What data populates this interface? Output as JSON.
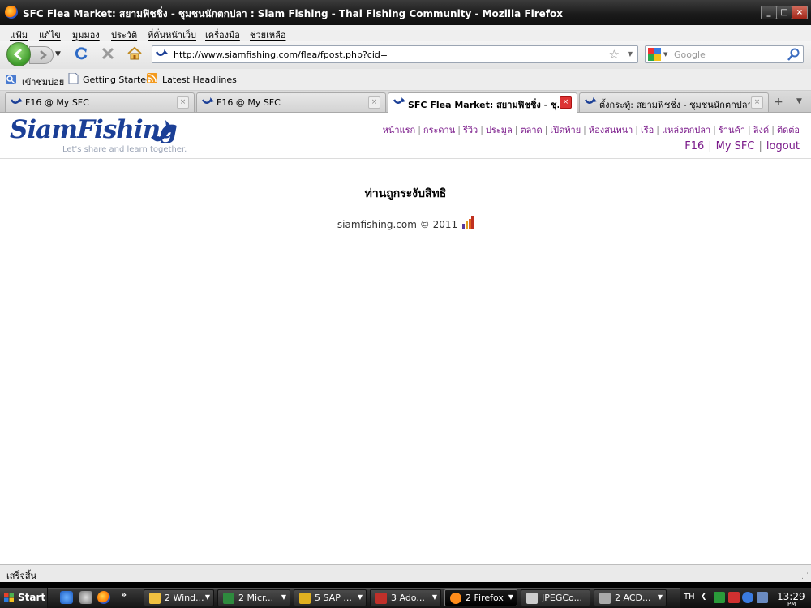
{
  "window": {
    "title": "SFC Flea Market: สยามฟิชชิ่ง - ชุมชนนักตกปลา : Siam Fishing - Thai Fishing Community - Mozilla Firefox"
  },
  "menu": [
    "แฟ้ม",
    "แก้ไข",
    "มุมมอง",
    "ประวัติ",
    "ที่คั่นหน้าเว็บ",
    "เครื่องมือ",
    "ช่วยเหลือ"
  ],
  "urlbar": {
    "url": "http://www.siamfishing.com/flea/fpost.php?cid="
  },
  "search": {
    "placeholder": "Google"
  },
  "bookmarks": [
    {
      "label": "เข้าชมบ่อย",
      "icon": "frequent-icon"
    },
    {
      "label": "Getting Started",
      "icon": "page-icon"
    },
    {
      "label": "Latest Headlines",
      "icon": "rss-icon"
    }
  ],
  "tabs": [
    {
      "label": "F16 @ My SFC",
      "active": false
    },
    {
      "label": "F16 @ My SFC",
      "active": false
    },
    {
      "label": "SFC Flea Market: สยามฟิชชิ่ง - ชุ...",
      "active": true
    },
    {
      "label": "ตั้งกระทู้: สยามฟิชชิ่ง - ชุมชนนักตกปลา...",
      "active": false
    }
  ],
  "site": {
    "logo_text": "SiamFishing",
    "tagline": "Let's share and learn together.",
    "nav": [
      "หน้าแรก",
      "กระดาน",
      "รีวิว",
      "ประมูล",
      "ตลาด",
      "เปิดท้าย",
      "ห้องสนทนา",
      "เรือ",
      "แหล่งตกปลา",
      "ร้านค้า",
      "ลิงค์",
      "ติดต่อ"
    ],
    "user_nav": {
      "username": "F16",
      "mysfc": "My SFC",
      "logout": "logout"
    },
    "message": "ท่านถูกระงับสิทธิ",
    "copyright": "siamfishing.com © 2011"
  },
  "status": {
    "text": "เสร็จสิ้น"
  },
  "taskbar": {
    "start": "Start",
    "quicklaunch_more": "»",
    "buttons": [
      {
        "label": "2 Wind...",
        "color": "#f0c040"
      },
      {
        "label": "2 Micr...",
        "color": "#2e8b3e"
      },
      {
        "label": "5 SAP ...",
        "color": "#e0b020"
      },
      {
        "label": "3 Ado...",
        "color": "#c0302a"
      },
      {
        "label": "2 Firefox",
        "color": "#ff8c1a",
        "active": true
      },
      {
        "label": "JPEGCo...",
        "color": "#cccccc"
      },
      {
        "label": "2 ACD...",
        "color": "#aaaaaa"
      }
    ],
    "lang": "TH",
    "clock": "13:29",
    "clock_ampm": "PM"
  },
  "colors": {
    "link": "#7a1a8a",
    "logo": "#1b3f96"
  }
}
